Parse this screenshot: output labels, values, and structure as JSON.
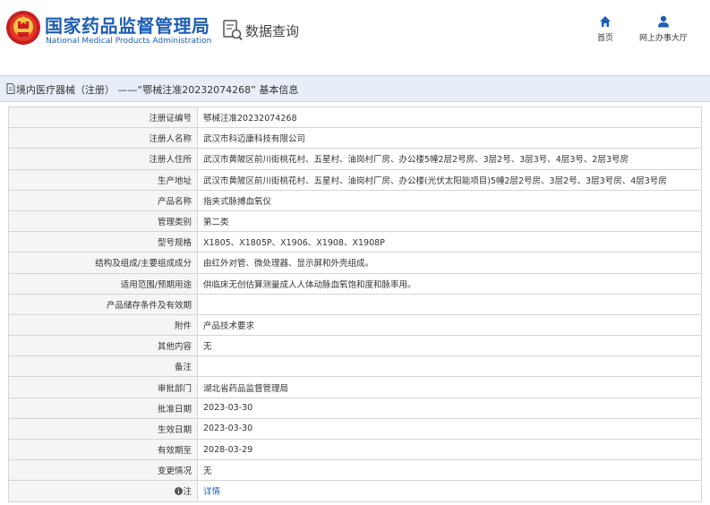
{
  "header": {
    "site_title_cn": "国家药品监督管理局",
    "site_title_en": "National Medical Products Administration",
    "query_title": "数据查询",
    "nav": [
      {
        "label": "首页",
        "icon": "home-icon"
      },
      {
        "label": "网上办事大厅",
        "icon": "user-icon"
      }
    ],
    "brand_color": "#1e5fb3"
  },
  "breadcrumb": {
    "text": "境内医疗器械（注册） ——“鄂械注准20232074268” 基本信息",
    "icon": "document-icon"
  },
  "details": [
    {
      "label": "注册证编号",
      "value": "鄂械注准20232074268"
    },
    {
      "label": "注册人名称",
      "value": "武汉市科迈康科技有限公司"
    },
    {
      "label": "注册人住所",
      "value": "武汉市黄陂区前川街桃花村、五星村、油岗村厂房、办公楼5幢2层2号房、3层2号、3层3号、4层3号、2层3号房"
    },
    {
      "label": "生产地址",
      "value": "武汉市黄陂区前川街桃花村、五星村、油岗村厂房、办公楼(光伏太阳能项目)5幢2层2号房、3层2号、3层3号房、4层3号房"
    },
    {
      "label": "产品名称",
      "value": "指夹式脉搏血氧仪"
    },
    {
      "label": "管理类别",
      "value": "第二类"
    },
    {
      "label": "型号规格",
      "value": "X1805、X1805P、X1906、X1908、X1908P"
    },
    {
      "label": "结构及组成/主要组成成分",
      "value": "由红外对管、微处理器、显示屏和外壳组成。"
    },
    {
      "label": "适用范围/预期用途",
      "value": "供临床无创估算测量成人人体动脉血氧饱和度和脉率用。"
    },
    {
      "label": "产品储存条件及有效期",
      "value": ""
    },
    {
      "label": "附件",
      "value": "产品技术要求"
    },
    {
      "label": "其他内容",
      "value": "无"
    },
    {
      "label": "备注",
      "value": ""
    },
    {
      "label": "审批部门",
      "value": "湖北省药品监督管理局"
    },
    {
      "label": "批准日期",
      "value": "2023-03-30"
    },
    {
      "label": "生效日期",
      "value": "2023-03-30"
    },
    {
      "label": "有效期至",
      "value": "2028-03-29"
    },
    {
      "label": "变更情况",
      "value": "无"
    },
    {
      "label": "注",
      "value": "详情",
      "label_icon": "info-icon"
    }
  ]
}
